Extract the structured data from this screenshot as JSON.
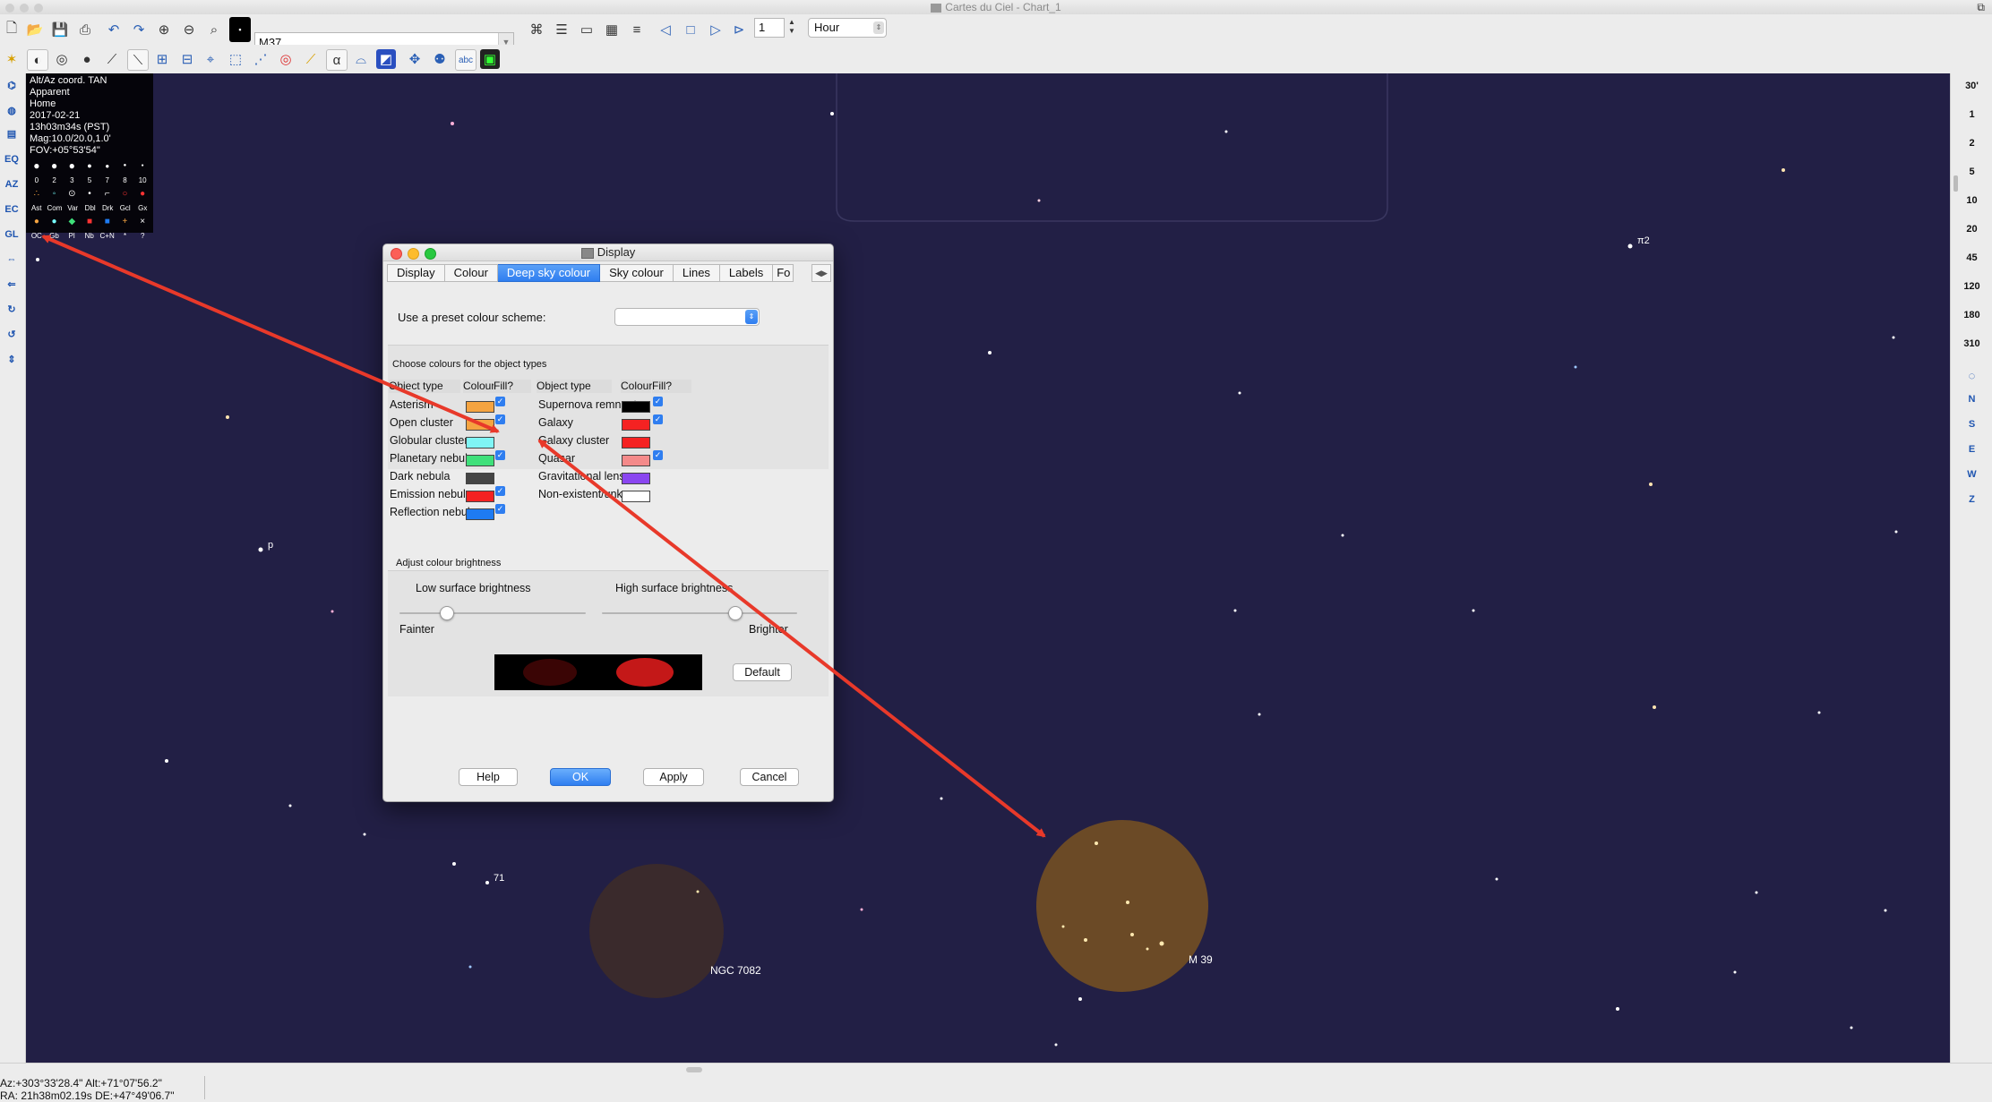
{
  "window": {
    "title": "Cartes du Ciel - Chart_1"
  },
  "toolbar": {
    "search_value": "M37",
    "step_value": "1",
    "time_unit": "Hour"
  },
  "left_sidebar": [
    "EQ",
    "AZ",
    "EC",
    "GL"
  ],
  "right_sidebar": {
    "fov_items": [
      "30'",
      "1",
      "2",
      "5",
      "10",
      "20",
      "45",
      "120",
      "180",
      "310"
    ],
    "directions": [
      "N",
      "S",
      "E",
      "W",
      "Z"
    ]
  },
  "info": {
    "lines": [
      "Alt/Az coord. TAN",
      "Apparent",
      "Home",
      "2017-02-21",
      "13h03m34s (PST)",
      "Mag:10.0/20.0,1.0'",
      "FOV:+05°53'54\""
    ],
    "mag_labels": [
      "0",
      "2",
      "3",
      "5",
      "7",
      "8",
      "10"
    ],
    "type_labels_1": [
      "Ast",
      "Com",
      "Var",
      "Dbl",
      "Drk",
      "Gcl",
      "Gx"
    ],
    "type_labels_2": [
      "OC",
      "Gb",
      "Pl",
      "Nb",
      "C+N",
      "*",
      "?"
    ]
  },
  "sky_labels": {
    "ngc7082": "NGC 7082",
    "m39": "M 39",
    "star_71": "71",
    "star_p": "p",
    "star_pi2": "π2"
  },
  "status": {
    "line1": "Az:+303°33'28.4\" Alt:+71°07'56.2\"",
    "line2": "RA: 21h38m02.19s DE:+47°49'06.7\""
  },
  "dialog": {
    "title": "Display",
    "tabs": [
      "Display",
      "Colour",
      "Deep sky colour",
      "Sky colour",
      "Lines",
      "Labels",
      "Fo"
    ],
    "active_tab": "Deep sky colour",
    "preset_label": "Use a preset colour scheme:",
    "preset_value": "",
    "group_title": "Choose colours for the object types",
    "headers": {
      "type": "Object type",
      "colour": "Colour",
      "fill": "Fill?"
    },
    "left_objects": [
      {
        "name": "Asterism",
        "color": "#f5a441",
        "fill": true
      },
      {
        "name": "Open cluster",
        "color": "#f5a441",
        "fill": true
      },
      {
        "name": "Globular cluster",
        "color": "#7ff5f5",
        "fill": false
      },
      {
        "name": "Planetary nebula",
        "color": "#3fe07a",
        "fill": true
      },
      {
        "name": "Dark nebula",
        "color": "#444444",
        "fill": false
      },
      {
        "name": "Emission nebula",
        "color": "#f52222",
        "fill": true
      },
      {
        "name": "Reflection nebula",
        "color": "#1e7bf2",
        "fill": true
      }
    ],
    "right_objects": [
      {
        "name": "Supernova remnant",
        "color": "#000000",
        "fill": true
      },
      {
        "name": "Galaxy",
        "color": "#f52222",
        "fill": true
      },
      {
        "name": "Galaxy cluster",
        "color": "#f52222",
        "fill": false
      },
      {
        "name": "Quasar",
        "color": "#f48a8a",
        "fill": true
      },
      {
        "name": "Gravitational lens",
        "color": "#8a46f0",
        "fill": false
      },
      {
        "name": "Non-existent/unknown",
        "color": "#ffffff",
        "fill": false
      }
    ],
    "brightness_title": "Adjust colour brightness",
    "low_label": "Low surface brightness",
    "high_label": "High surface brightness",
    "fainter": "Fainter",
    "brighter": "Brighter",
    "low_level": 0.25,
    "high_level": 0.68,
    "default_button": "Default",
    "buttons": {
      "help": "Help",
      "ok": "OK",
      "apply": "Apply",
      "cancel": "Cancel"
    }
  },
  "colors": {
    "sky": "#221f45",
    "annotation_arrow": "#e8392a",
    "cluster_fill": "#6b4a26",
    "accent": "#2f7ef0"
  }
}
